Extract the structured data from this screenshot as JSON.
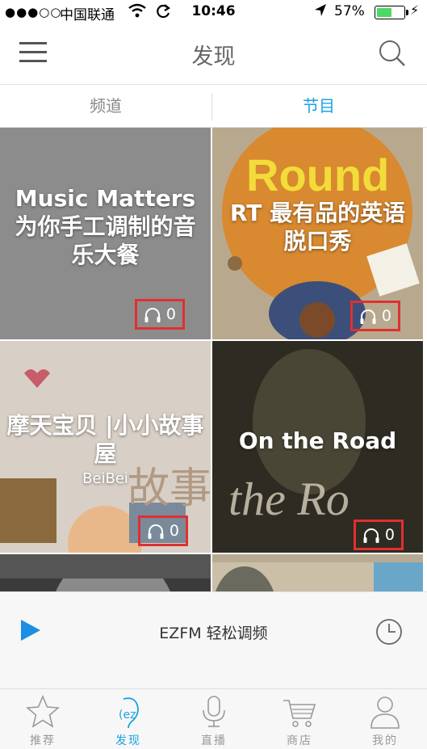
{
  "status_bar": {
    "signal": "●●●○○",
    "carrier": "中国联通",
    "time": "10:46",
    "battery_percent": "57%",
    "battery_level": 0.57,
    "battery_color": "#4cd964"
  },
  "navbar": {
    "title": "发现",
    "menu_icon": "hamburger-menu-icon",
    "search_icon": "search-icon"
  },
  "tabs": {
    "channel": "频道",
    "program": "节目",
    "active": "program",
    "active_color": "#1aa3e0"
  },
  "cards": [
    {
      "title": "Music Matters 为你手工调制的音乐大餐",
      "listens": "0"
    },
    {
      "title": "RT 最有品的英语脱口秀",
      "listens": "0"
    },
    {
      "title": "摩天宝贝 |小小故事屋",
      "subtitle": "BeiBei",
      "listens": "0"
    },
    {
      "title": "On the Road",
      "listens": "0"
    },
    {
      "title": "",
      "listens": ""
    },
    {
      "title": "",
      "listens": ""
    }
  ],
  "player": {
    "title": "EZFM 轻松调频",
    "play_icon": "play-icon",
    "history_icon": "clock-icon",
    "accent": "#1a8fe3"
  },
  "tabbar": {
    "items": [
      {
        "label": "推荐",
        "icon": "star-icon"
      },
      {
        "label": "发现",
        "icon": "ez-ear-icon"
      },
      {
        "label": "直播",
        "icon": "microphone-icon"
      },
      {
        "label": "商店",
        "icon": "cart-icon"
      },
      {
        "label": "我的",
        "icon": "person-icon"
      }
    ],
    "active": "发现"
  }
}
